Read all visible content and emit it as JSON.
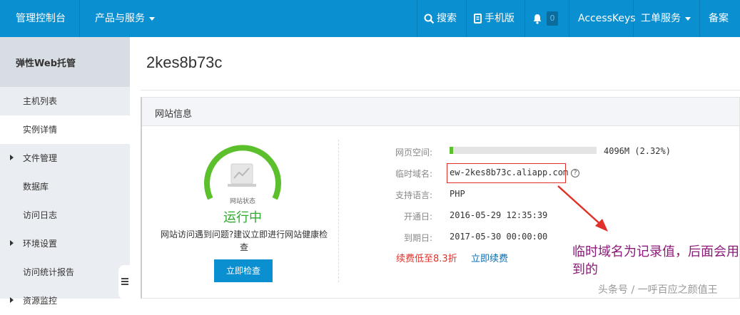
{
  "topnav": {
    "console": "管理控制台",
    "products": "产品与服务",
    "search": "搜索",
    "mobile": "手机版",
    "notifications_count": "0",
    "accesskeys": "AccessKeys",
    "tickets": "工单服务",
    "beian": "备案"
  },
  "sidebar": {
    "header": "弹性Web托管",
    "items": [
      {
        "label": "主机列表"
      },
      {
        "label": "实例详情"
      },
      {
        "label": "文件管理"
      },
      {
        "label": "数据库"
      },
      {
        "label": "访问日志"
      },
      {
        "label": "环境设置"
      },
      {
        "label": "访问统计报告"
      },
      {
        "label": "资源监控"
      }
    ]
  },
  "main": {
    "title": "2kes8b73c",
    "panel_title": "网站信息",
    "gauge_label": "网站状态",
    "status": "运行中",
    "hint": "网站访问遇到问题?建议立即进行网站健康检查",
    "check_button": "立即检查",
    "fields": {
      "space_label": "网页空间:",
      "space_value": "4096M (2.32%)",
      "space_usage_percent": 2.32,
      "domain_label": "临时域名:",
      "domain_value": "ew-2kes8b73c.aliapp.com",
      "lang_label": "支持语言:",
      "lang_value": "PHP",
      "start_label": "开通日:",
      "start_value": "2016-05-29 12:35:39",
      "end_label": "到期日:",
      "end_value": "2017-05-30 00:00:00"
    },
    "renew_promo": "续费低至8.3折",
    "renew_link": "立即续费"
  },
  "annotation": "临时域名为记录值，后面会用到的",
  "watermark": "头条号 / 一呼百应之颜值王",
  "colors": {
    "topbar": "#0a8fd1",
    "status_green": "#2ea82e",
    "annotation_red": "#e0302a",
    "annotation_text": "#8b1a7a"
  }
}
